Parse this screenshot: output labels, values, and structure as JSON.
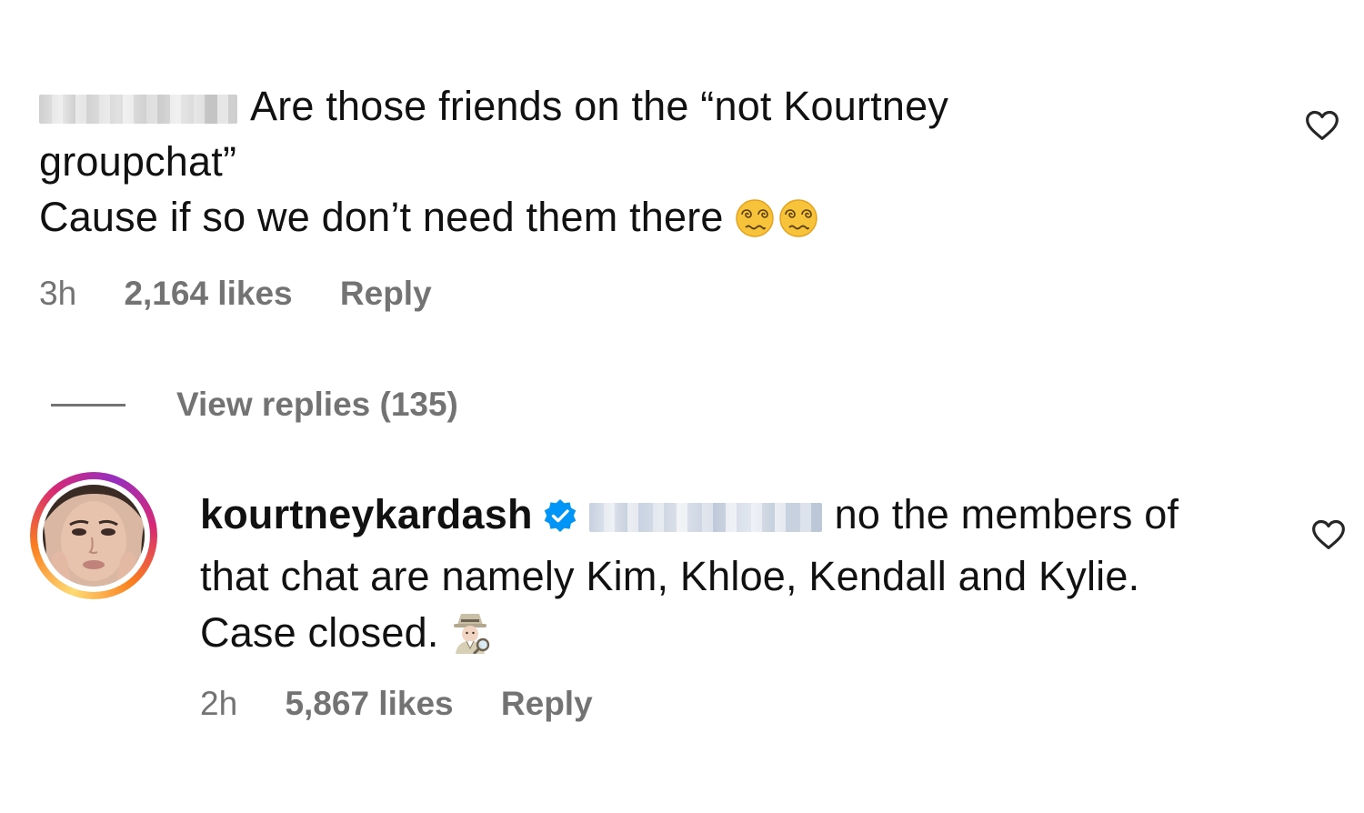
{
  "comments": [
    {
      "username_blurred": true,
      "text_line1": "Are those friends on the “not Kourtney",
      "text_line2": "groupchat”",
      "text_line3": "Cause if so we don’t need them there",
      "emoji": "face-with-spiral-eyes",
      "time": "3h",
      "likes": "2,164 likes",
      "reply_label": "Reply"
    },
    {
      "username": "kourtneykardash",
      "verified": true,
      "mention_blurred": true,
      "text_line1": "no the members of",
      "text_line2": "that chat are namely Kim, Khloe, Kendall and Kylie.",
      "text_line3": "Case closed.",
      "emoji": "detective",
      "time": "2h",
      "likes": "5,867 likes",
      "reply_label": "Reply"
    }
  ],
  "view_replies": "View replies (135)",
  "colors": {
    "text": "#111111",
    "meta": "#737373",
    "verified": "#0095f6"
  }
}
